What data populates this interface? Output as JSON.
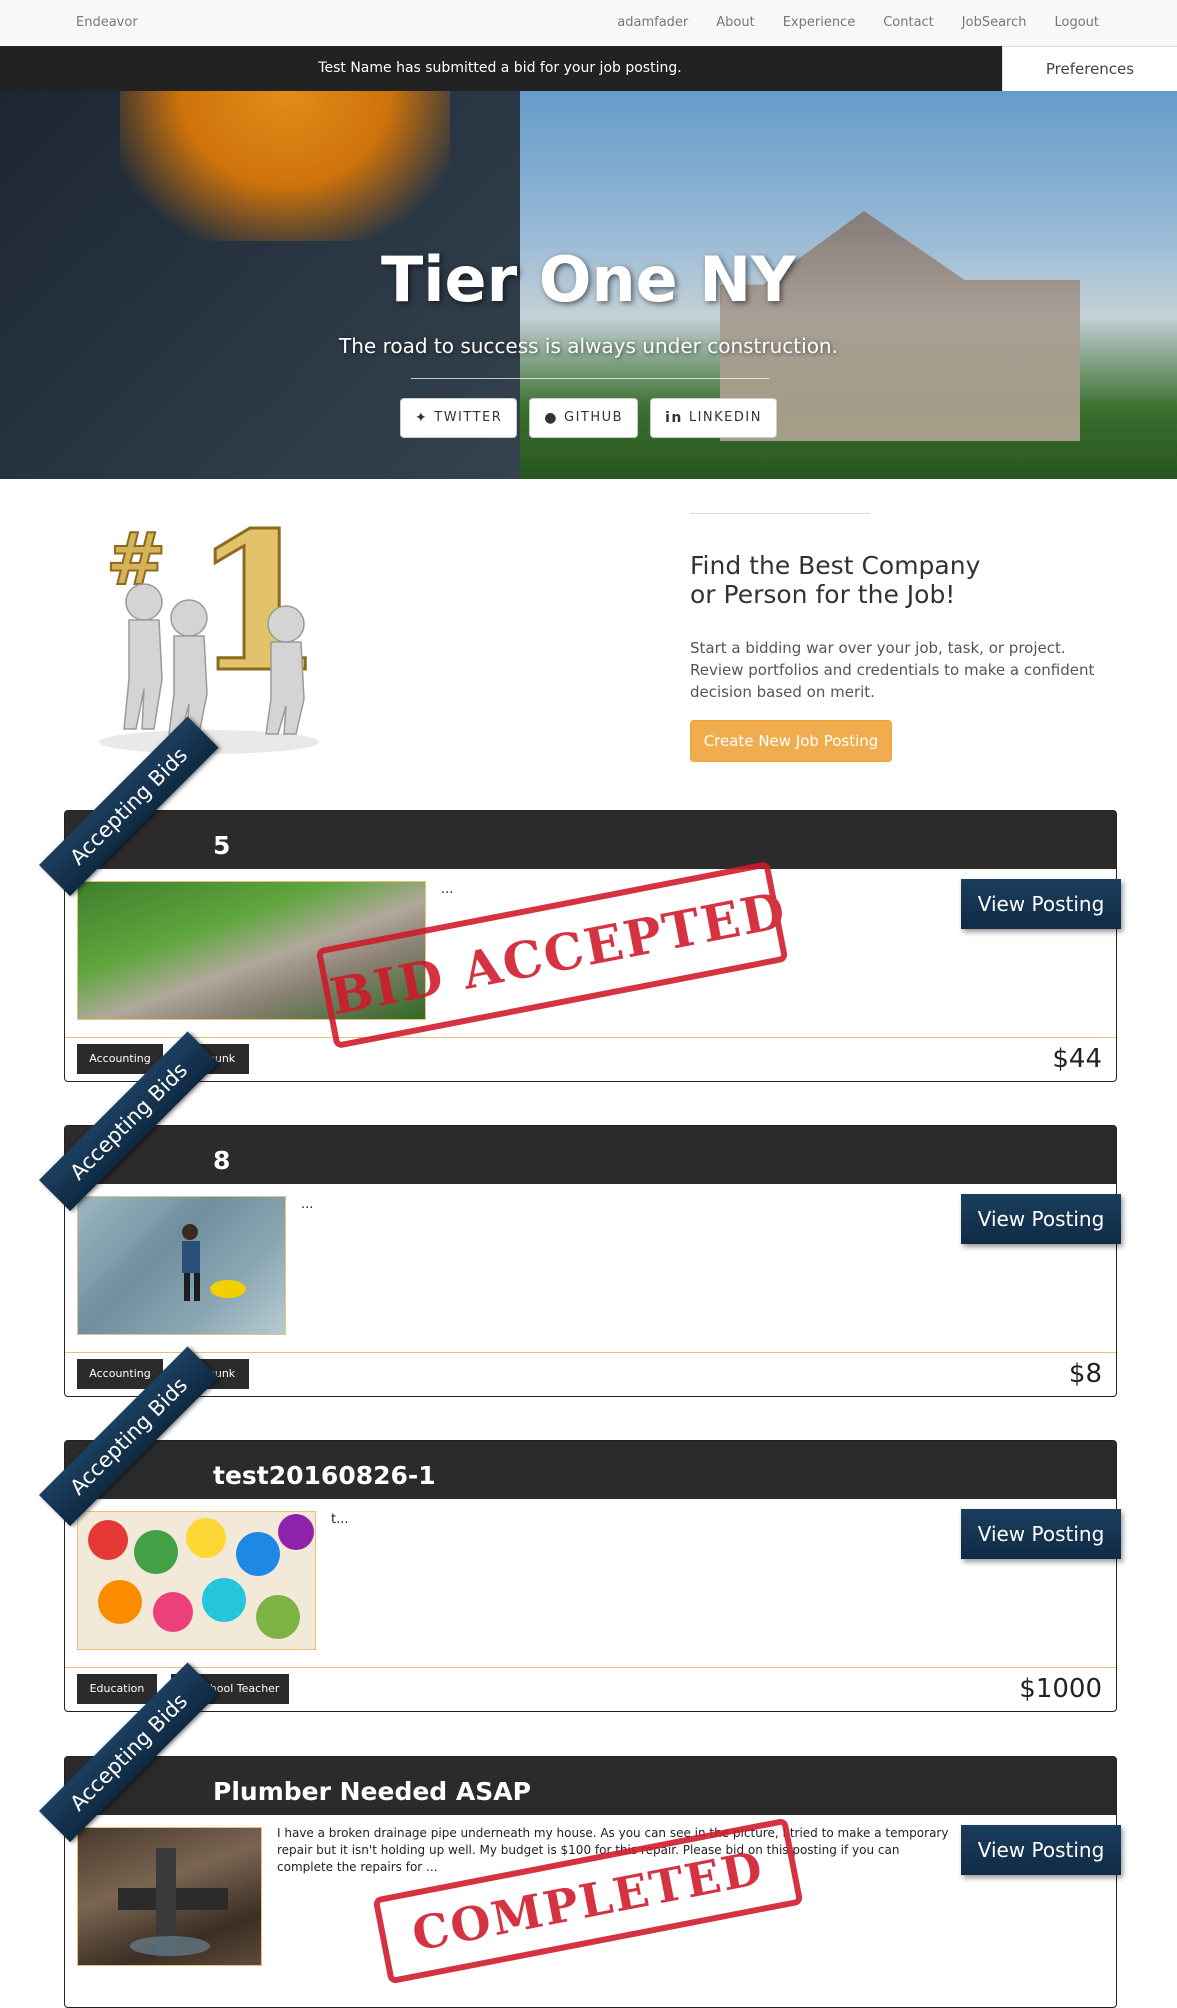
{
  "nav": {
    "brand": "Endeavor",
    "links": [
      "adamfader",
      "About",
      "Experience",
      "Contact",
      "JobSearch",
      "Logout"
    ]
  },
  "notification": {
    "text": "Test Name has submitted a bid for your job posting.",
    "preferences_label": "Preferences"
  },
  "hero": {
    "title": "Tier One NY",
    "subtitle": "The road to success is always under construction.",
    "social": [
      {
        "label": "TWITTER",
        "icon": "twitter-icon"
      },
      {
        "label": "GITHUB",
        "icon": "github-icon"
      },
      {
        "label": "LINKEDIN",
        "icon": "linkedin-icon"
      }
    ]
  },
  "intro": {
    "heading_line1": "Find the Best Company",
    "heading_line2": "or Person for the Job!",
    "text": "Start a bidding war over your job, task, or project. Review portfolios and credentials to make a confident decision based on merit.",
    "button": "Create New Job Posting",
    "image_icon": "number-one-trophy-icon"
  },
  "postings": [
    {
      "ribbon": "Accepting Bids",
      "title": "5",
      "description": "...",
      "button": "View Posting",
      "tags": [
        "Accounting",
        "art punk"
      ],
      "price": "$44",
      "stamp": "BID ACCEPTED",
      "image": "garden-path-image",
      "color": "#d01828"
    },
    {
      "ribbon": "Accepting Bids",
      "title": "8",
      "description": "...",
      "button": "View Posting",
      "tags": [
        "Accounting",
        "art punk"
      ],
      "price": "$8",
      "image": "floor-cleaning-image"
    },
    {
      "ribbon": "Accepting Bids",
      "title": "test20160826-1",
      "description": "t...",
      "button": "View Posting",
      "tags": [
        "Education",
        "Preschool Teacher"
      ],
      "price": "$1000",
      "image": "colorful-letters-image"
    },
    {
      "ribbon": "Accepting Bids",
      "title": "Plumber Needed ASAP",
      "description": "I have a broken drainage pipe underneath my house. As you can see in the picture, I tried to make a temporary repair but it isn't holding up well. My budget is $100 for this repair. Please bid on this posting if you can complete the repairs for ...",
      "button": "View Posting",
      "stamp": "COMPLETED",
      "image": "broken-pipe-image"
    }
  ],
  "colors": {
    "nav_dark": "#222222",
    "accent_orange": "#f0ad4e",
    "ribbon_blue": "#0e2941",
    "stamp_red": "#d01828"
  }
}
